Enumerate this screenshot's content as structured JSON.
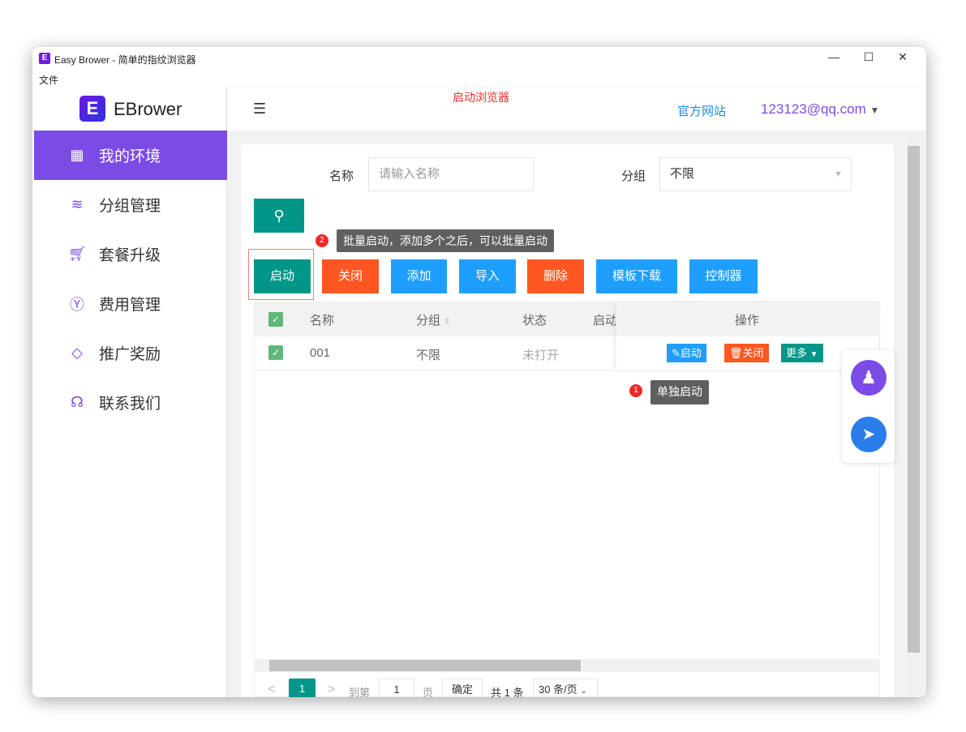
{
  "window": {
    "title": "Easy Brower - 简单的指纹浏览器",
    "logo_letter": "E",
    "minimize": "—",
    "maximize": "☐",
    "close": "✕"
  },
  "menu": {
    "file": "文件"
  },
  "sidebar": {
    "logo_letter": "E",
    "brand": "EBrower",
    "items": [
      {
        "label": "我的环境",
        "icon": "grid-icon"
      },
      {
        "label": "分组管理",
        "icon": "layers-icon"
      },
      {
        "label": "套餐升级",
        "icon": "cart-icon"
      },
      {
        "label": "费用管理",
        "icon": "yen-icon"
      },
      {
        "label": "推广奖励",
        "icon": "diamond-icon"
      },
      {
        "label": "联系我们",
        "icon": "headset-icon"
      }
    ]
  },
  "header": {
    "annotation": "启动浏览器",
    "official_site": "官方网站",
    "user": "123123@qq.com"
  },
  "filters": {
    "name_label": "名称",
    "name_placeholder": "请输入名称",
    "group_label": "分组",
    "group_value": "不限"
  },
  "toolbar": {
    "start": "启动",
    "close": "关闭",
    "add": "添加",
    "import": "导入",
    "delete": "删除",
    "template": "模板下载",
    "controller": "控制器"
  },
  "tips": {
    "batch_num": "2",
    "batch": "批量启动，添加多个之后，可以批量启动",
    "single_num": "1",
    "single": "单独启动"
  },
  "table": {
    "headers": {
      "name": "名称",
      "group": "分组",
      "status": "状态",
      "start": "启动",
      "ops": "操作"
    },
    "rows": [
      {
        "name": "001",
        "group": "不限",
        "status": "未打开",
        "op_start": "启动",
        "op_close": "关闭",
        "op_more": "更多"
      }
    ]
  },
  "pagination": {
    "page": "1",
    "goto": "到第",
    "goto_value": "1",
    "page_unit": "页",
    "confirm": "确定",
    "total": "共 1 条",
    "per_page": "30 条/页"
  },
  "colors": {
    "accent": "#7b4be6",
    "teal": "#009688",
    "orange": "#ff5722",
    "blue": "#1e9fff"
  }
}
